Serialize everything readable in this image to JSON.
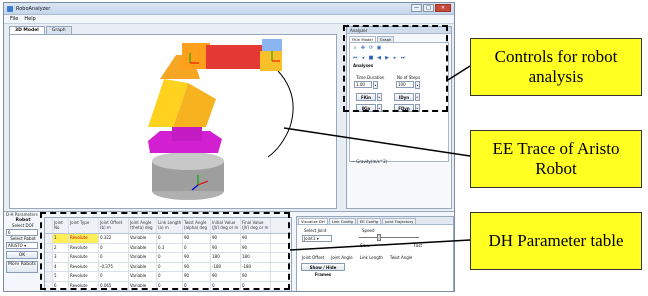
{
  "window": {
    "title": "RoboAnalyzer",
    "controls": {
      "minimize": "—",
      "maximize": "□",
      "close": "✕"
    }
  },
  "menu": [
    "File",
    "Help"
  ],
  "doc_tabs": [
    "3D Model",
    "Graph"
  ],
  "side_panel": {
    "header": "Analyzer",
    "tabs": [
      "FKin Model",
      "Graph"
    ],
    "play_icons": [
      "rewind-icon",
      "step-back-icon",
      "stop-icon",
      "play-back-icon",
      "play-icon",
      "step-forward-icon",
      "fast-forward-icon"
    ],
    "view_icons": [
      "zoom-icon",
      "pan-icon",
      "rotate-icon",
      "reset-view-icon"
    ],
    "section_label": "Analyses",
    "time_duration_label": "Time Duration",
    "time_duration_value": "1.00",
    "no_of_steps_label": "No of Steps",
    "no_of_steps_value": "100",
    "buttons": [
      "FKin",
      "IDyn",
      "IKin",
      "FDyn"
    ],
    "gravity_label": "— Gravity(m/s^2)"
  },
  "bottom_panel": {
    "header": "D-H Parameters",
    "robot_label": "Robot",
    "select_dof_label": "Select DOF",
    "dof_value": "6",
    "select_robot_label": "Select Robot",
    "robot_value": "ARISTO ▾",
    "ok_button": "OK",
    "more_robots_button": "More Robots"
  },
  "dh_table": {
    "headers": [
      "",
      "Joint No",
      "Joint Type",
      "Joint Offset (b) m",
      "Joint Angle (theta) deg",
      "Link Length (a) m",
      "Twist Angle (alpha) deg",
      "Initial Value (JV) deg or m",
      "Final Value (JV) deg or m"
    ],
    "rows": [
      [
        "",
        "1",
        "Revolute",
        "0.322",
        "Variable",
        "0",
        "90",
        "90",
        "90"
      ],
      [
        "",
        "2",
        "Revolute",
        "0",
        "Variable",
        "0.3",
        "0",
        "90",
        "90"
      ],
      [
        "",
        "3",
        "Revolute",
        "0",
        "Variable",
        "0",
        "90",
        "180",
        "180"
      ],
      [
        "",
        "4",
        "Revolute",
        "-0.375",
        "Variable",
        "0",
        "90",
        "-180",
        "-180"
      ],
      [
        "",
        "5",
        "Revolute",
        "0",
        "Variable",
        "0",
        "90",
        "90",
        "90"
      ],
      [
        "",
        "6",
        "Revolute",
        "0.065",
        "Variable",
        "0",
        "0",
        "0",
        "0"
      ]
    ]
  },
  "viz_panel": {
    "tabs": [
      "Visualize DH",
      "Link Config",
      "EE Config",
      "Joint Trajectory"
    ],
    "select_joint_label": "Select Joint",
    "joint_value": "Joint1 ▾",
    "speed_label": "Speed",
    "slow_label": "Slow",
    "fast_label": "Fast",
    "bottom_items": [
      "Joint Offset",
      "Joint Angle",
      "Link Length",
      "Twist Angle"
    ],
    "show_button": "Show / Hide Frames"
  },
  "callouts": {
    "controls": "Controls for robot analysis",
    "ee_trace": "EE Trace of Aristo Robot",
    "dh_table": "DH Parameter table"
  },
  "colors": {
    "callout_fill": "#ffff22",
    "robot_orange": "#f6a623",
    "robot_red": "#e53935",
    "robot_yellow": "#ffd21f",
    "robot_magenta": "#d21fd2",
    "robot_base": "#9e9e9e",
    "selected_row": "#ffee55"
  }
}
